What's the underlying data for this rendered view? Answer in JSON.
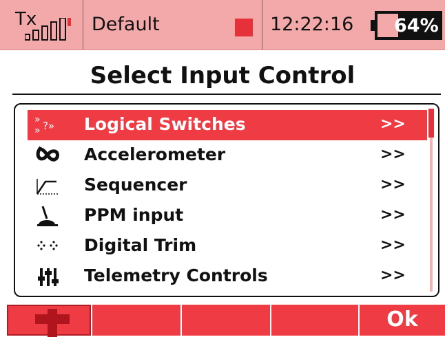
{
  "status": {
    "tx_label": "Tx",
    "profile": "Default",
    "time": "12:22:16",
    "battery": "64%",
    "battery_level": 0.64
  },
  "title": "Select Input Control",
  "list": {
    "items": [
      {
        "icon": "logical-switches-icon",
        "label": "Logical Switches",
        "arrow": ">>",
        "selected": true
      },
      {
        "icon": "accelerometer-icon",
        "label": "Accelerometer",
        "arrow": ">>",
        "selected": false
      },
      {
        "icon": "sequencer-icon",
        "label": "Sequencer",
        "arrow": ">>",
        "selected": false
      },
      {
        "icon": "ppm-input-icon",
        "label": "PPM input",
        "arrow": ">>",
        "selected": false
      },
      {
        "icon": "digital-trim-icon",
        "label": "Digital Trim",
        "arrow": ">>",
        "selected": false
      },
      {
        "icon": "telemetry-controls-icon",
        "label": "Telemetry Controls",
        "arrow": ">>",
        "selected": false
      }
    ]
  },
  "buttons": {
    "f1_icon": "plus-icon",
    "f5_label": "Ok"
  },
  "colors": {
    "accent": "#ee3b44",
    "status_bg": "#f3a9a9"
  }
}
